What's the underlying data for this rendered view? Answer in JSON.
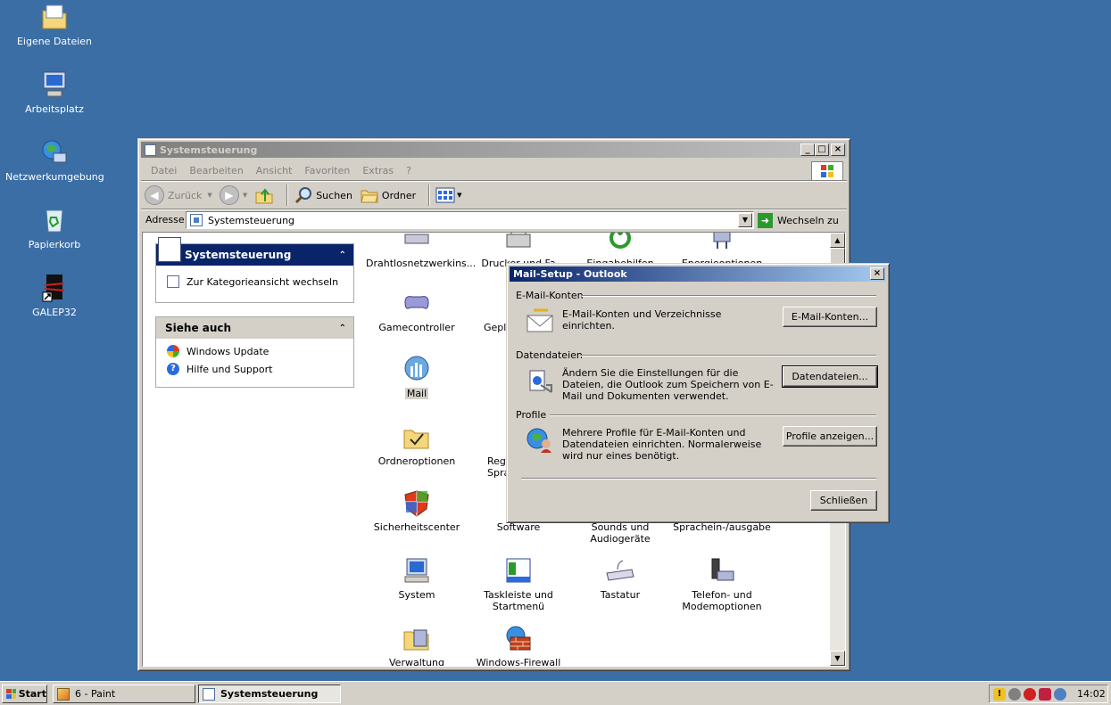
{
  "desktop": {
    "icons": [
      {
        "label": "Eigene Dateien"
      },
      {
        "label": "Arbeitsplatz"
      },
      {
        "label": "Netzwerkumgebung"
      },
      {
        "label": "Papierkorb"
      },
      {
        "label": "GALEP32"
      }
    ]
  },
  "explorer": {
    "title": "Systemsteuerung",
    "menu": [
      "Datei",
      "Bearbeiten",
      "Ansicht",
      "Favoriten",
      "Extras",
      "?"
    ],
    "toolbar": {
      "back": "Zurück",
      "search": "Suchen",
      "folders": "Ordner"
    },
    "address": {
      "label": "Adresse",
      "value": "Systemsteuerung",
      "go": "Wechseln zu"
    },
    "sidebar": {
      "panel_title": "Systemsteuerung",
      "switch_link": "Zur Kategorieansicht wechseln",
      "see_also_title": "Siehe auch",
      "see_also": [
        "Windows Update",
        "Hilfe und Support"
      ]
    },
    "items": [
      {
        "label": "Drahtlosnetzwerkins..."
      },
      {
        "label": "Drucker und Fa"
      },
      {
        "label": "Eingabehilfen"
      },
      {
        "label": "Energieoptionen"
      },
      {
        "label": "Gamecontroller"
      },
      {
        "label": "Gepl"
      },
      {
        "label": "Mail"
      },
      {
        "label": "Ordneroptionen"
      },
      {
        "label": "Reg Spra"
      },
      {
        "label": "Sicherheitscenter"
      },
      {
        "label": "Software"
      },
      {
        "label": "Sounds und Audiogeräte"
      },
      {
        "label": "Sprachein-/ausgabe"
      },
      {
        "label": "System"
      },
      {
        "label": "Taskleiste und Startmenü"
      },
      {
        "label": "Tastatur"
      },
      {
        "label": "Telefon- und Modemoptionen"
      },
      {
        "label": "Verwaltung"
      },
      {
        "label": "Windows-Firewall"
      }
    ]
  },
  "dialog": {
    "title": "Mail-Setup - Outlook",
    "groups": [
      {
        "title": "E-Mail-Konten",
        "text": "E-Mail-Konten und Verzeichnisse einrichten.",
        "button": "E-Mail-Konten..."
      },
      {
        "title": "Datendateien",
        "text": "Ändern Sie die Einstellungen für die Dateien, die Outlook zum Speichern von E-Mail und Dokumenten verwendet.",
        "button": "Datendateien..."
      },
      {
        "title": "Profile",
        "text": "Mehrere Profile für E-Mail-Konten und Datendateien einrichten. Normalerweise wird nur eines benötigt.",
        "button": "Profile anzeigen..."
      }
    ],
    "close_button": "Schließen"
  },
  "taskbar": {
    "start": "Start",
    "tasks": [
      "6 - Paint",
      "Systemsteuerung"
    ],
    "clock": "14:02"
  }
}
